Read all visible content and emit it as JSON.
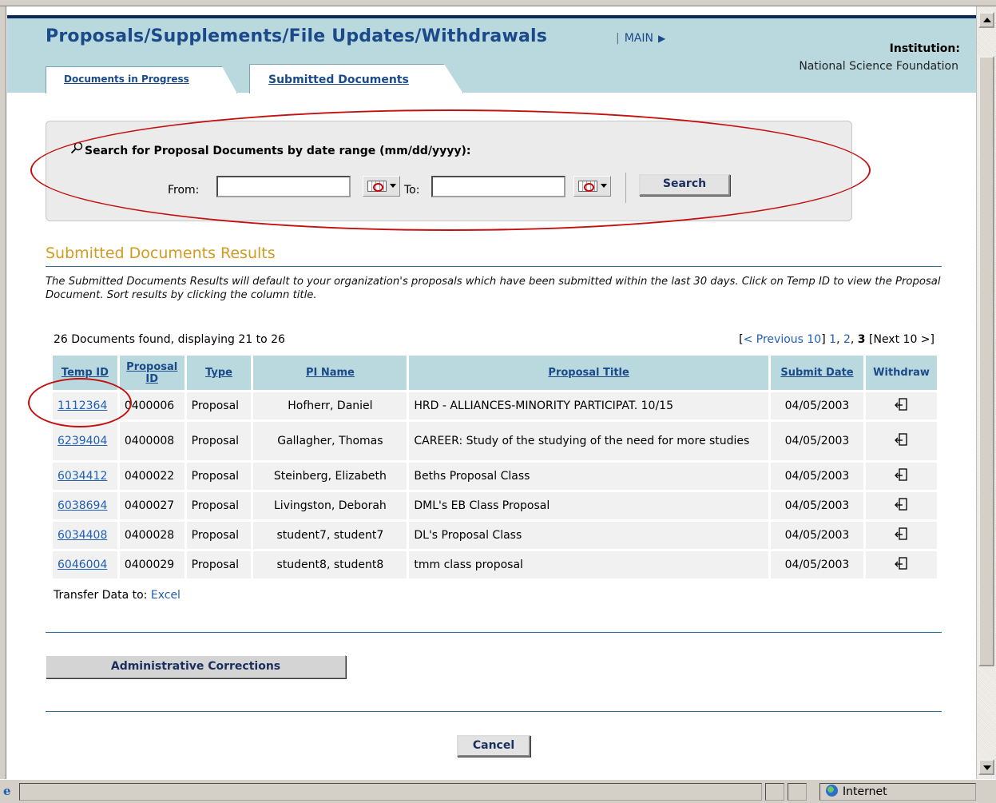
{
  "header": {
    "title": "Proposals/Supplements/File Updates/Withdrawals",
    "main_link": "MAIN",
    "institution_label": "Institution:",
    "institution_value": "National Science Foundation"
  },
  "tabs": [
    {
      "label": "Documents in Progress",
      "active": false
    },
    {
      "label": "Submitted Documents",
      "active": true
    }
  ],
  "search": {
    "title": "Search for Proposal Documents by date range (mm/dd/yyyy):",
    "from_label": "From:",
    "from_value": "",
    "to_label": "To:",
    "to_value": "",
    "button_label": "Search"
  },
  "results": {
    "title": "Submitted Documents Results",
    "description": "The Submitted Documents Results will default to your organization's proposals which have been submitted within the last 30 days. Click on Temp ID to view the Proposal Document. Sort results by clicking the column title.",
    "found_text": "26 Documents found, displaying 21 to 26",
    "pager": {
      "prev": "< Previous 10",
      "pages": [
        "1",
        "2",
        "3"
      ],
      "current": "3",
      "next": "Next 10 >"
    },
    "columns": [
      "Temp ID",
      "Proposal ID",
      "Type",
      "PI Name",
      "Proposal Title",
      "Submit Date",
      "Withdraw"
    ],
    "rows": [
      {
        "temp_id": "1112364",
        "proposal_id": "0400006",
        "type": "Proposal",
        "pi_name": "Hofherr, Daniel",
        "title": "HRD - ALLIANCES-MINORITY PARTICIPAT. 10/15",
        "date": "04/05/2003"
      },
      {
        "temp_id": "6239404",
        "proposal_id": "0400008",
        "type": "Proposal",
        "pi_name": "Gallagher, Thomas",
        "title": "CAREER: Study of the studying of the need for more studies",
        "date": "04/05/2003"
      },
      {
        "temp_id": "6034412",
        "proposal_id": "0400022",
        "type": "Proposal",
        "pi_name": "Steinberg, Elizabeth",
        "title": "Beths Proposal Class",
        "date": "04/05/2003"
      },
      {
        "temp_id": "6038694",
        "proposal_id": "0400027",
        "type": "Proposal",
        "pi_name": "Livingston, Deborah",
        "title": "DML's EB Class Proposal",
        "date": "04/05/2003"
      },
      {
        "temp_id": "6034408",
        "proposal_id": "0400028",
        "type": "Proposal",
        "pi_name": "student7, student7",
        "title": "DL's Proposal Class",
        "date": "04/05/2003"
      },
      {
        "temp_id": "6046004",
        "proposal_id": "0400029",
        "type": "Proposal",
        "pi_name": "student8, student8",
        "title": "tmm class proposal",
        "date": "04/05/2003"
      }
    ],
    "transfer_label": "Transfer Data to:",
    "transfer_link": "Excel"
  },
  "buttons": {
    "admin_corrections": "Administrative Corrections",
    "cancel": "Cancel"
  },
  "statusbar": {
    "zone": "Internet"
  },
  "icons": {
    "search": "magnifier-icon",
    "calendar": "calendar-icon",
    "withdraw": "withdraw-icon",
    "browser": "ie-icon",
    "zone": "globe-icon"
  },
  "colors": {
    "header_band": "#b9d9de",
    "title_blue": "#1b4a8a",
    "results_title": "#d39b1e",
    "annotation_red": "#c41010",
    "link": "#1f5fb4"
  }
}
